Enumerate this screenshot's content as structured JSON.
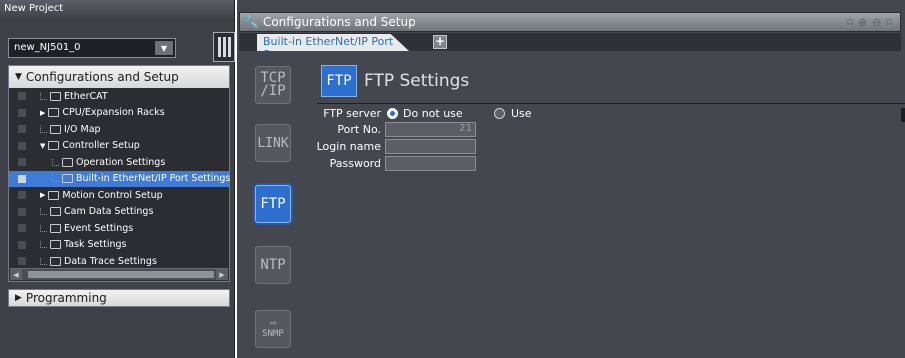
{
  "left_pane": {
    "title": "New Project",
    "device": {
      "name": "new_NJ501_0",
      "arrow": "▼"
    },
    "config_header": {
      "toggle": "▼",
      "label": "Configurations and Setup"
    },
    "tree": [
      {
        "label": "EtherCAT",
        "twisty": "",
        "icon": "ethercat-icon"
      },
      {
        "label": "CPU/Expansion Racks",
        "twisty": "▶",
        "icon": "rack-icon"
      },
      {
        "label": "I/O Map",
        "twisty": "",
        "icon": "io-map-icon"
      },
      {
        "label": "Controller Setup",
        "twisty": "▼",
        "icon": "controller-icon"
      },
      {
        "label": "Operation Settings",
        "twisty": "",
        "icon": "operation-icon"
      },
      {
        "label": "Built-in EtherNet/IP Port Settings",
        "twisty": "",
        "icon": "ethernet-icon",
        "selected": true
      },
      {
        "label": "Motion Control Setup",
        "twisty": "▶",
        "icon": "gear-icon"
      },
      {
        "label": "Cam Data Settings",
        "twisty": "",
        "icon": "cam-icon"
      },
      {
        "label": "Event Settings",
        "twisty": "",
        "icon": "flag-icon"
      },
      {
        "label": "Task Settings",
        "twisty": "",
        "icon": "task-icon"
      },
      {
        "label": "Data Trace Settings",
        "twisty": "",
        "icon": "trace-icon"
      }
    ],
    "scroll_left": "◀",
    "scroll_right": "▶",
    "programming": {
      "toggle": "▶",
      "label": "Programming"
    }
  },
  "main": {
    "title": "Configurations and Setup",
    "title_tools": [
      "⌑",
      "⊕",
      "⊖",
      "⌑"
    ],
    "tab_label": "Built-in EtherNet/IP Port Se",
    "tab_add": "+",
    "categories": {
      "tcp_line1": "TCP",
      "tcp_line2": "/IP",
      "link": "LINK",
      "ftp": "FTP",
      "ntp": "NTP",
      "snmp_arrow": "⇨",
      "snmp": "SNMP"
    },
    "settings": {
      "badge": "FTP",
      "title": "FTP Settings",
      "ftp_server_label": "FTP server",
      "option_do_not_use": "Do not use",
      "option_use": "Use",
      "selected_option": "Do not use",
      "port_label": "Port No.",
      "port_value": "21",
      "login_label": "Login name",
      "login_value": "",
      "password_label": "Password",
      "password_value": ""
    }
  },
  "colors": {
    "accent_blue": "#2d6fcf",
    "selection": "#3f7bd8",
    "wrench": "#ff7a1a",
    "panel_dark": "#44474d"
  }
}
